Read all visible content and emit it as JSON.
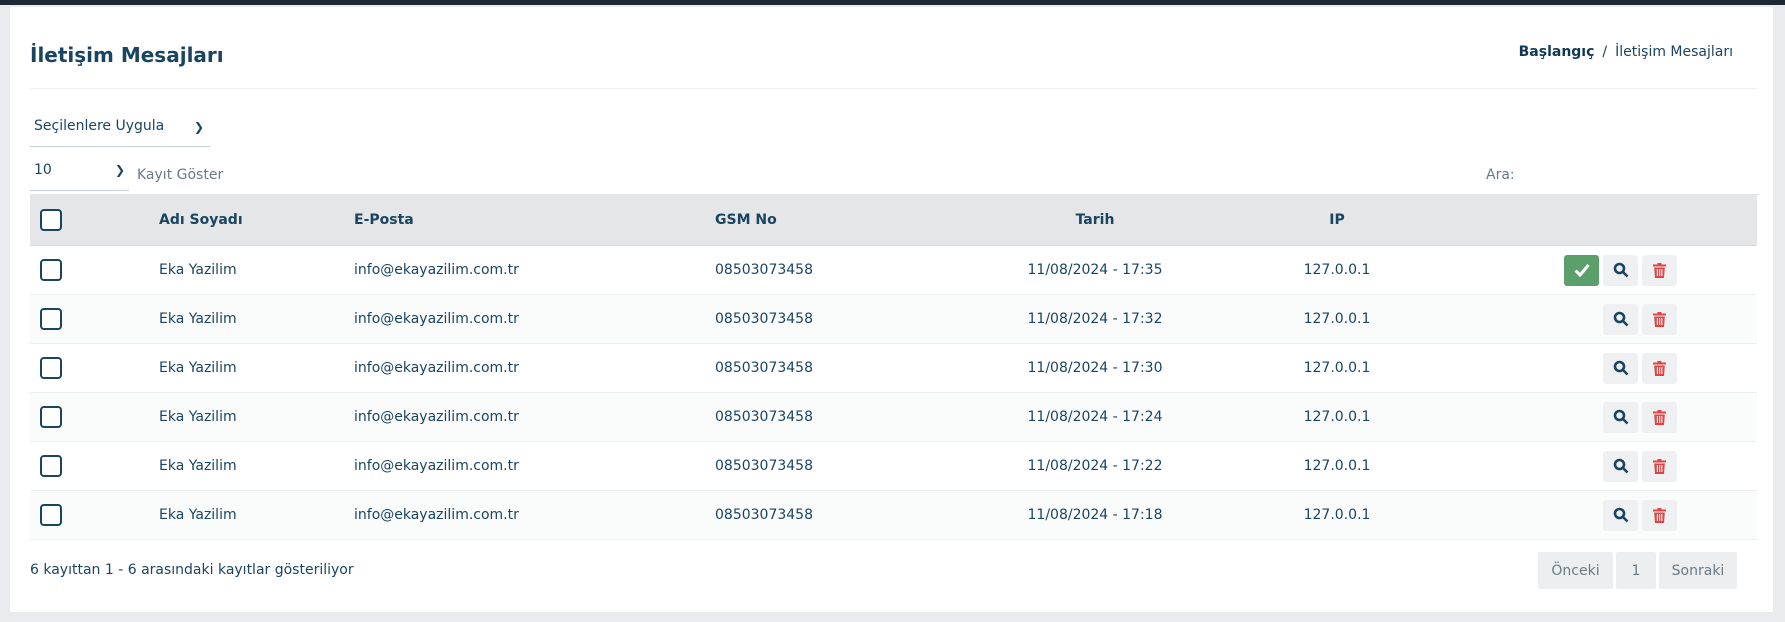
{
  "header": {
    "title": "İletişim Mesajları",
    "breadcrumb": {
      "home": "Başlangıç",
      "separator": "/",
      "current": "İletişim Mesajları"
    }
  },
  "controls": {
    "bulk_action": {
      "selected": "Seçilenlere Uygula"
    },
    "page_length": {
      "selected": "10",
      "label": "Kayıt Göster"
    },
    "search": {
      "label": "Ara:",
      "value": ""
    }
  },
  "table": {
    "columns": [
      "Adı Soyadı",
      "E-Posta",
      "GSM No",
      "Tarih",
      "IP"
    ],
    "rows": [
      {
        "name": "Eka Yazilim",
        "email": "info@ekayazilim.com.tr",
        "gsm": "08503073458",
        "date": "11/08/2024 - 17:35",
        "ip": "127.0.0.1",
        "approve_icon": "check-icon"
      },
      {
        "name": "Eka Yazilim",
        "email": "info@ekayazilim.com.tr",
        "gsm": "08503073458",
        "date": "11/08/2024 - 17:32",
        "ip": "127.0.0.1"
      },
      {
        "name": "Eka Yazilim",
        "email": "info@ekayazilim.com.tr",
        "gsm": "08503073458",
        "date": "11/08/2024 - 17:30",
        "ip": "127.0.0.1"
      },
      {
        "name": "Eka Yazilim",
        "email": "info@ekayazilim.com.tr",
        "gsm": "08503073458",
        "date": "11/08/2024 - 17:24",
        "ip": "127.0.0.1"
      },
      {
        "name": "Eka Yazilim",
        "email": "info@ekayazilim.com.tr",
        "gsm": "08503073458",
        "date": "11/08/2024 - 17:22",
        "ip": "127.0.0.1"
      },
      {
        "name": "Eka Yazilim",
        "email": "info@ekayazilim.com.tr",
        "gsm": "08503073458",
        "date": "11/08/2024 - 17:18",
        "ip": "127.0.0.1"
      }
    ]
  },
  "footer": {
    "info": "6 kayıttan 1 - 6 arasındaki kayıtlar gösteriliyor",
    "pagination": {
      "prev": "Önceki",
      "page": "1",
      "next": "Sonraki"
    }
  },
  "icons": {
    "view": "search-icon",
    "delete": "trash-icon",
    "select": "chevron-down-icon"
  },
  "colors": {
    "accent": "#1a4560",
    "approve": "#5ba06b",
    "delete": "#e04444"
  }
}
